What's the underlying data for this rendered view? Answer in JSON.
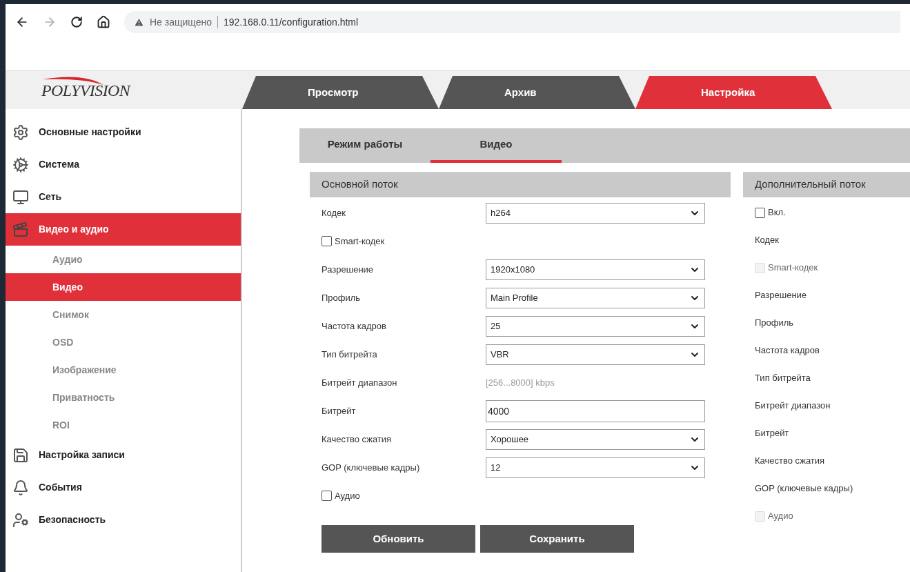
{
  "browser": {
    "back_enabled": true,
    "forward_enabled": false,
    "security": "Не защищено",
    "url": "192.168.0.11/configuration.html"
  },
  "header": {
    "logo": "POLYVISION",
    "tabs": [
      {
        "label": "Просмотр",
        "selected": false
      },
      {
        "label": "Архив",
        "selected": false
      },
      {
        "label": "Настройка",
        "selected": true
      }
    ]
  },
  "sidebar": {
    "items": [
      {
        "label": "Основные настройки",
        "selected": false
      },
      {
        "label": "Система",
        "selected": false
      },
      {
        "label": "Сеть",
        "selected": false
      },
      {
        "label": "Видео и аудио",
        "selected": true,
        "children": [
          {
            "label": "Аудио",
            "selected": false
          },
          {
            "label": "Видео",
            "selected": true
          },
          {
            "label": "Снимок",
            "selected": false
          },
          {
            "label": "OSD",
            "selected": false
          },
          {
            "label": "Изображение",
            "selected": false
          },
          {
            "label": "Приватность",
            "selected": false
          },
          {
            "label": "ROI",
            "selected": false
          }
        ]
      },
      {
        "label": "Настройка записи",
        "selected": false
      },
      {
        "label": "События",
        "selected": false
      },
      {
        "label": "Безопасность",
        "selected": false
      }
    ]
  },
  "subtabs": [
    {
      "label": "Режим работы",
      "selected": false
    },
    {
      "label": "Видео",
      "selected": true
    }
  ],
  "main_stream": {
    "title": "Основной поток",
    "rows": [
      {
        "kind": "select",
        "label": "Кодек",
        "value": "h264"
      },
      {
        "kind": "checkbox",
        "label": "Smart-кодек",
        "checked": false,
        "disabled": false
      },
      {
        "kind": "select",
        "label": "Разрешение",
        "value": "1920x1080"
      },
      {
        "kind": "select",
        "label": "Профиль",
        "value": "Main Profile"
      },
      {
        "kind": "select",
        "label": "Частота кадров",
        "value": "25"
      },
      {
        "kind": "select",
        "label": "Тип битрейта",
        "value": "VBR"
      },
      {
        "kind": "text",
        "label": "Битрейт диапазон",
        "value": "[256...8000] kbps"
      },
      {
        "kind": "input",
        "label": "Битрейт",
        "value": "4000"
      },
      {
        "kind": "select",
        "label": "Качество сжатия",
        "value": "Хорошее"
      },
      {
        "kind": "select",
        "label": "GOP (ключевые кадры)",
        "value": "12"
      },
      {
        "kind": "checkbox",
        "label": "Аудио",
        "checked": false,
        "disabled": false
      }
    ]
  },
  "extra_stream": {
    "title": "Дополнительный поток",
    "rows": [
      {
        "kind": "checkbox",
        "label": "Вкл.",
        "checked": false,
        "disabled": false
      },
      {
        "kind": "label",
        "label": "Кодек"
      },
      {
        "kind": "checkbox",
        "label": "Smart-кодек",
        "checked": false,
        "disabled": true
      },
      {
        "kind": "label",
        "label": "Разрешение"
      },
      {
        "kind": "label",
        "label": "Профиль"
      },
      {
        "kind": "label",
        "label": "Частота кадров"
      },
      {
        "kind": "label",
        "label": "Тип битрейта"
      },
      {
        "kind": "label",
        "label": "Битрейт диапазон"
      },
      {
        "kind": "label",
        "label": "Битрейт"
      },
      {
        "kind": "label",
        "label": "Качество сжатия"
      },
      {
        "kind": "label",
        "label": "GOP (ключевые кадры)"
      },
      {
        "kind": "checkbox",
        "label": "Аудио",
        "checked": false,
        "disabled": true
      }
    ]
  },
  "buttons": [
    "Обновить",
    "Сохранить"
  ]
}
